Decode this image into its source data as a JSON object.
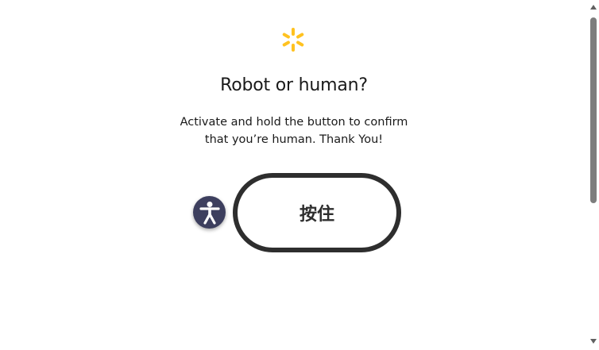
{
  "logo": {
    "icon": "walmart-spark-icon",
    "color": "#FFC220"
  },
  "heading": "Robot or human?",
  "description": {
    "line1": "Activate and hold the button to confirm",
    "line2": "that you’re human. Thank You!"
  },
  "accessibility_button": {
    "icon": "accessibility-person-icon",
    "color": "#3d3f5e"
  },
  "hold_button": {
    "label": "按住"
  },
  "scrollbar": {
    "up_icon": "scroll-up-arrow-icon",
    "down_icon": "scroll-down-arrow-icon"
  }
}
